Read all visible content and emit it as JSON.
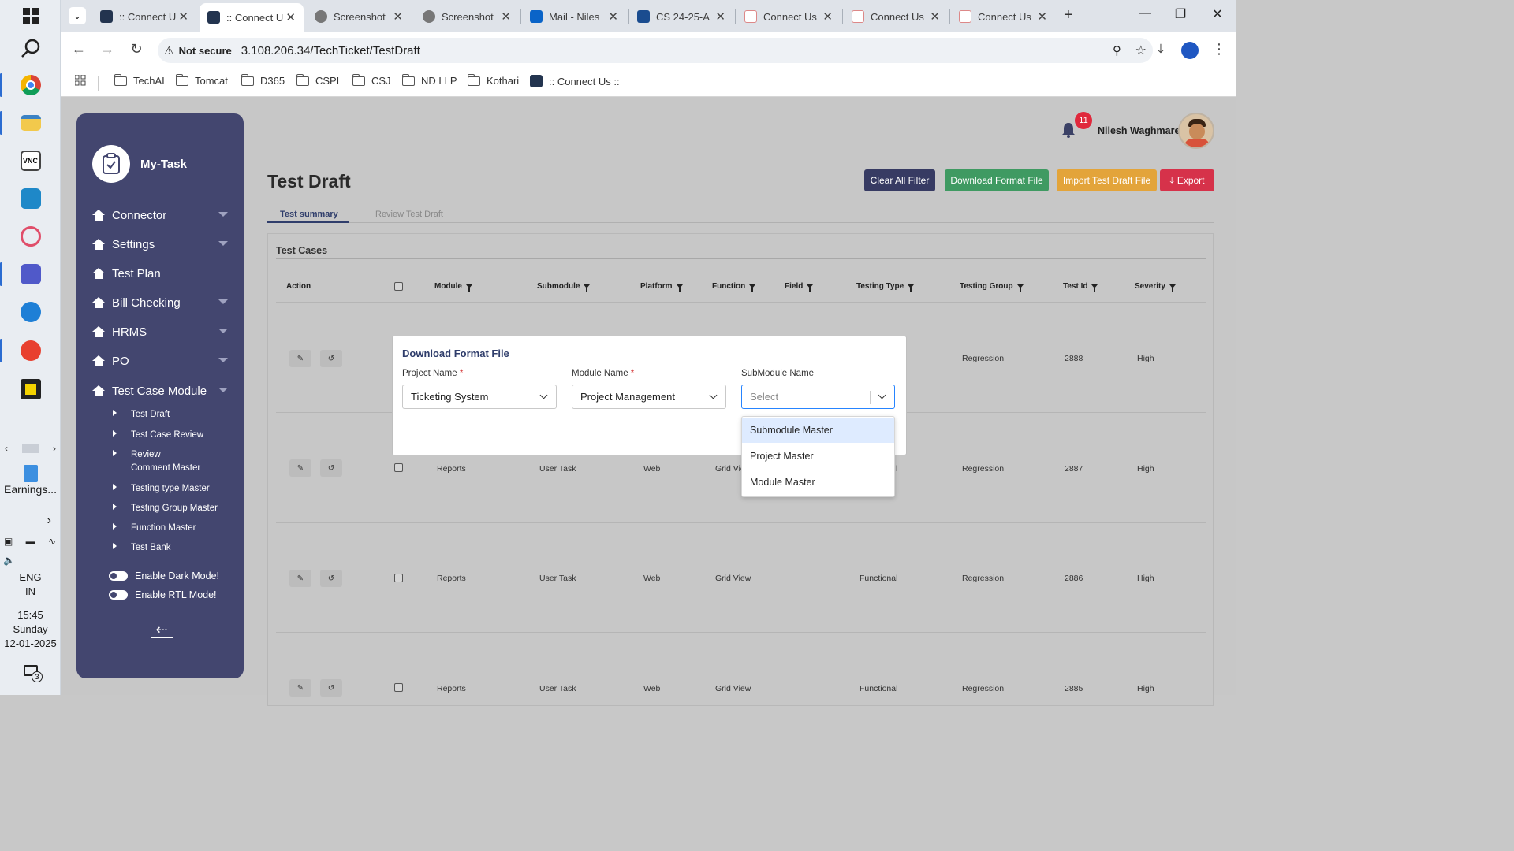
{
  "taskbar": {
    "search_label": "Search",
    "pinned_text": "Earnings...",
    "lang_line1": "ENG",
    "lang_line2": "IN",
    "time": "15:45",
    "day": "Sunday",
    "date": "12-01-2025",
    "notif_count": "3"
  },
  "browser": {
    "tabs": [
      {
        "label": ":: Connect U",
        "icon": "react-icon"
      },
      {
        "label": ":: Connect U",
        "icon": "react-icon",
        "active": true
      },
      {
        "label": "Screenshot",
        "icon": "globe-icon"
      },
      {
        "label": "Screenshot",
        "icon": "globe-icon"
      },
      {
        "label": "Mail - Niles",
        "icon": "outlook-icon"
      },
      {
        "label": "CS 24-25-A",
        "icon": "app-icon"
      },
      {
        "label": "Connect Us",
        "icon": "connect-icon"
      },
      {
        "label": "Connect Us",
        "icon": "connect-icon"
      },
      {
        "label": "Connect Us",
        "icon": "connect-icon"
      }
    ],
    "security_label": "Not secure",
    "url": "3.108.206.34/TechTicket/TestDraft",
    "bookmarks": [
      "TechAI",
      "Tomcat",
      "D365",
      "CSPL",
      "CSJ",
      "ND LLP",
      "Kothari",
      ":: Connect Us ::"
    ]
  },
  "sidebar": {
    "app_name": "My-Task",
    "items": [
      {
        "label": "Connector",
        "has_caret": true
      },
      {
        "label": "Settings",
        "has_caret": true
      },
      {
        "label": "Test Plan",
        "has_caret": false
      },
      {
        "label": "Bill Checking",
        "has_caret": true
      },
      {
        "label": "HRMS",
        "has_caret": true
      },
      {
        "label": "PO",
        "has_caret": true
      },
      {
        "label": "Test Case Module",
        "has_caret": true
      }
    ],
    "sub_items": [
      "Test Draft",
      "Test Case Review",
      "Review Comment Master",
      "Testing type Master",
      "Testing Group Master",
      "Function Master",
      "Test Bank"
    ],
    "toggles": [
      "Enable Dark Mode!",
      "Enable RTL Mode!"
    ]
  },
  "header": {
    "notification_count": "11",
    "user_name": "Nilesh Waghmare"
  },
  "page": {
    "title": "Test Draft",
    "buttons": {
      "clear": "Clear All Filter",
      "download": "Download Format File",
      "import": "Import Test Draft File",
      "export": "Export"
    },
    "tabs": [
      "Test summary",
      "Review Test Draft"
    ],
    "panel_title": "Test Cases"
  },
  "table": {
    "columns": [
      "Action",
      "Module",
      "Submodule",
      "Platform",
      "Function",
      "Field",
      "Testing Type",
      "Testing Group",
      "Test Id",
      "Severity"
    ],
    "rows": [
      {
        "module": "",
        "submodule": "",
        "platform": "",
        "function": "",
        "testing_type": "",
        "testing_group": "Regression",
        "test_id": "2888",
        "severity": "High"
      },
      {
        "module": "Reports",
        "submodule": "User Task",
        "platform": "Web",
        "function": "Grid Vie",
        "testing_type": "l",
        "testing_group": "Regression",
        "test_id": "2887",
        "severity": "High"
      },
      {
        "module": "Reports",
        "submodule": "User Task",
        "platform": "Web",
        "function": "Grid View",
        "testing_type": "Functional",
        "testing_group": "Regression",
        "test_id": "2886",
        "severity": "High"
      },
      {
        "module": "Reports",
        "submodule": "User Task",
        "platform": "Web",
        "function": "Grid View",
        "testing_type": "Functional",
        "testing_group": "Regression",
        "test_id": "2885",
        "severity": "High"
      }
    ]
  },
  "modal": {
    "title": "Download Format File",
    "project_label": "Project Name",
    "project_value": "Ticketing System",
    "module_label": "Module Name",
    "module_value": "Project Management",
    "submodule_label": "SubModule Name",
    "submodule_placeholder": "Select",
    "required_mark": "*",
    "options": [
      "Submodule Master",
      "Project Master",
      "Module Master"
    ]
  },
  "colors": {
    "sidebar": "#43466f",
    "btn_clear": "#373b63",
    "btn_download": "#3f9a62",
    "btn_import": "#e3a43a",
    "btn_export": "#d6324a",
    "badge": "#e0283c"
  }
}
